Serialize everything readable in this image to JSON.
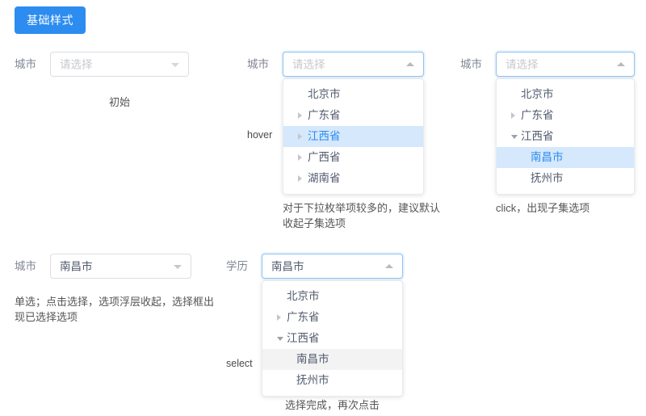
{
  "toolbar": {
    "basic_style_button": "基础样式"
  },
  "icons": {
    "caret_down": "caret-down-icon",
    "caret_up": "caret-up-icon",
    "tree_collapsed": "triangle-right-icon",
    "tree_expanded": "triangle-down-icon"
  },
  "colors": {
    "primary": "#2d8cf0",
    "hover_row_bg": "#d5e8fc",
    "selected_row_bg": "#f3f3f3",
    "border": "#dcdee2",
    "active_border": "#8ec3f0",
    "placeholder_text": "#c5c8ce",
    "label_text": "#808695"
  },
  "blocks": {
    "initial": {
      "label": "城市",
      "value": "",
      "placeholder": "请选择",
      "caption": "初始"
    },
    "hover": {
      "label": "城市",
      "value": "",
      "placeholder": "请选择",
      "state_label": "hover",
      "caption_line1": "对于下拉枚举项较多的，建议默认",
      "caption_line2": "收起子集选项",
      "options": [
        {
          "text": "北京市",
          "level": 1,
          "arrow": "none",
          "state": "normal"
        },
        {
          "text": "广东省",
          "level": 1,
          "arrow": "collapsed",
          "state": "normal"
        },
        {
          "text": "江西省",
          "level": 1,
          "arrow": "collapsed",
          "state": "hovered"
        },
        {
          "text": "广西省",
          "level": 1,
          "arrow": "collapsed",
          "state": "normal"
        },
        {
          "text": "湖南省",
          "level": 1,
          "arrow": "collapsed",
          "state": "normal"
        }
      ]
    },
    "click": {
      "label": "城市",
      "value": "",
      "placeholder": "请选择",
      "caption": "click，出现子集选项",
      "options": [
        {
          "text": "北京市",
          "level": 1,
          "arrow": "none",
          "state": "normal"
        },
        {
          "text": "广东省",
          "level": 1,
          "arrow": "collapsed",
          "state": "normal"
        },
        {
          "text": "江西省",
          "level": 1,
          "arrow": "expanded",
          "state": "normal"
        },
        {
          "text": "南昌市",
          "level": 2,
          "arrow": "none",
          "state": "hovered"
        },
        {
          "text": "抚州市",
          "level": 2,
          "arrow": "none",
          "state": "normal"
        }
      ]
    },
    "chosen": {
      "label": "城市",
      "value": "南昌市",
      "placeholder": "请选择",
      "caption_line1": "单选；点击选择，选项浮层收起，选择框出",
      "caption_line2": "现已选择选项"
    },
    "select": {
      "label": "学历",
      "value": "南昌市",
      "placeholder": "请选择",
      "state_label": "select",
      "caption": "选择完成，再次点击",
      "options": [
        {
          "text": "北京市",
          "level": 1,
          "arrow": "none",
          "state": "normal"
        },
        {
          "text": "广东省",
          "level": 1,
          "arrow": "collapsed",
          "state": "normal"
        },
        {
          "text": "江西省",
          "level": 1,
          "arrow": "expanded",
          "state": "normal"
        },
        {
          "text": "南昌市",
          "level": 2,
          "arrow": "none",
          "state": "selected"
        },
        {
          "text": "抚州市",
          "level": 2,
          "arrow": "none",
          "state": "normal"
        }
      ]
    }
  }
}
